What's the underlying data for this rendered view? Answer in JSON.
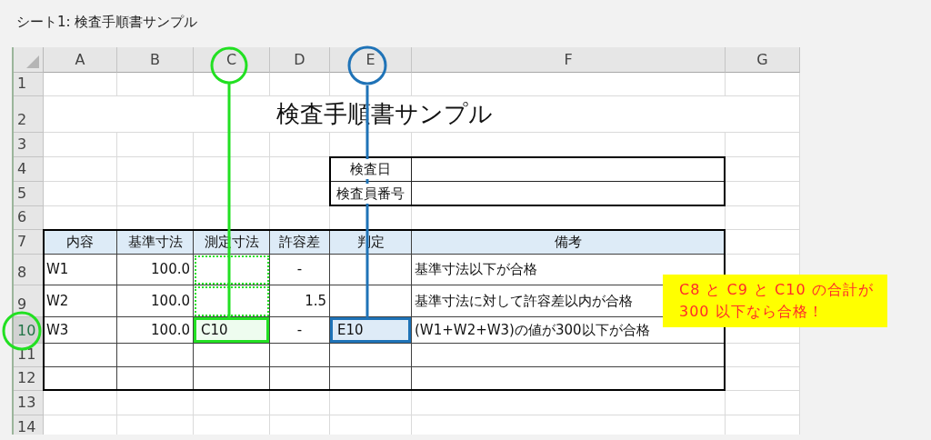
{
  "sheet_title": "シート1: 検査手順書サンプル",
  "columns": [
    {
      "label": "A"
    },
    {
      "label": "B"
    },
    {
      "label": "C"
    },
    {
      "label": "D"
    },
    {
      "label": "E"
    },
    {
      "label": "F"
    },
    {
      "label": "G"
    }
  ],
  "rows": [
    {
      "label": "1",
      "selected": false
    },
    {
      "label": "2",
      "selected": false
    },
    {
      "label": "3",
      "selected": false
    },
    {
      "label": "4",
      "selected": false
    },
    {
      "label": "5",
      "selected": false
    },
    {
      "label": "6",
      "selected": false
    },
    {
      "label": "7",
      "selected": false
    },
    {
      "label": "8",
      "selected": false
    },
    {
      "label": "9",
      "selected": false
    },
    {
      "label": "10",
      "selected": true
    },
    {
      "label": "11",
      "selected": false
    },
    {
      "label": "12",
      "selected": false
    },
    {
      "label": "13",
      "selected": false
    },
    {
      "label": "14",
      "selected": false
    }
  ],
  "title": "検査手順書サンプル",
  "inspection_info": [
    {
      "label": "検査日"
    },
    {
      "label": "検査員番号"
    }
  ],
  "table": {
    "columns": [
      "内容",
      "基準寸法",
      "測定寸法",
      "許容差",
      "判定",
      "備考"
    ],
    "rows": [
      {
        "item": "W1",
        "standard": "100.0",
        "measured": {
          "kind": "dotted"
        },
        "tolerance": "-",
        "note": "基準寸法以下が合格"
      },
      {
        "item": "W2",
        "standard": "100.0",
        "measured": {
          "kind": "dotted"
        },
        "tolerance": "1.5",
        "note": "基準寸法に対して許容差以内が合格"
      },
      {
        "item": "W3",
        "standard": "100.0",
        "measured": {
          "text": "C10",
          "kind": "solid"
        },
        "tolerance": "-",
        "judgement": {
          "text": "E10",
          "kind": "solid"
        },
        "note": "(W1+W2+W3)の値が300以下が合格"
      }
    ]
  },
  "callout": "C8 と C9 と C10 の合計が\n300 以下なら合格！"
}
